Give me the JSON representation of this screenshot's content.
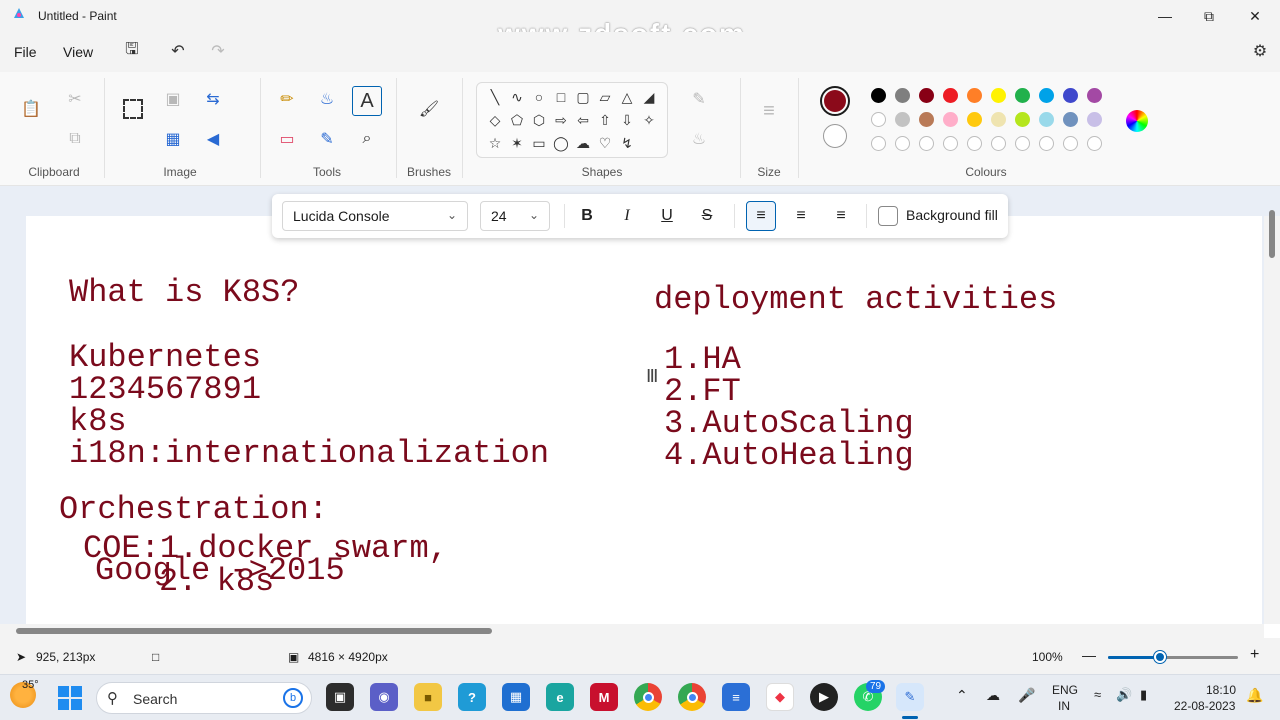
{
  "window": {
    "title": "Untitled - Paint",
    "watermark": "www.zdsoft.com"
  },
  "menu": {
    "file": "File",
    "view": "View"
  },
  "ribbon": {
    "groups": {
      "clipboard": "Clipboard",
      "image": "Image",
      "tools": "Tools",
      "brushes": "Brushes",
      "shapes": "Shapes",
      "size": "Size",
      "colours": "Colours"
    },
    "current_color": "#8b0a1a",
    "palette_row1": [
      "#000000",
      "#7f7f7f",
      "#880015",
      "#ed1c24",
      "#ff7f27",
      "#fff200",
      "#22b14c",
      "#00a2e8",
      "#3f48cc",
      "#a349a4"
    ],
    "palette_row2": [
      "#ffffff",
      "#c3c3c3",
      "#b97a57",
      "#ffaec9",
      "#ffc90e",
      "#efe4b0",
      "#b5e61d",
      "#99d9ea",
      "#7092be",
      "#c8bfe7"
    ]
  },
  "textbar": {
    "font": "Lucida Console",
    "size": "24",
    "background_fill": "Background fill",
    "bold": "B",
    "italic": "I",
    "underline": "U",
    "strike": "S"
  },
  "canvas": {
    "left_text": {
      "line1": "What is K8S?",
      "line2": "Kubernetes",
      "line3": "1234567891",
      "line4": "k8s",
      "line5": "i18n:internationalization",
      "line6": "Orchestration:",
      "line7": "COE:1.docker swarm,",
      "line8": "Google ->2015",
      "line9": "2. k8s"
    },
    "right_text": {
      "heading": "deployment activities",
      "item1": "1.HA",
      "item2": "2.FT",
      "item3": "3.AutoScaling",
      "item4": "4.AutoHealing"
    }
  },
  "status": {
    "cursor": "925, 213px",
    "canvas_size": "4816 × 4920px",
    "zoom": "100%",
    "zoom_level_percent": 100
  },
  "taskbar": {
    "weather": "35°",
    "search": "Search",
    "badge": "79",
    "lang1": "ENG",
    "lang2": "IN",
    "time": "18:10",
    "date": "22-08-2023"
  }
}
